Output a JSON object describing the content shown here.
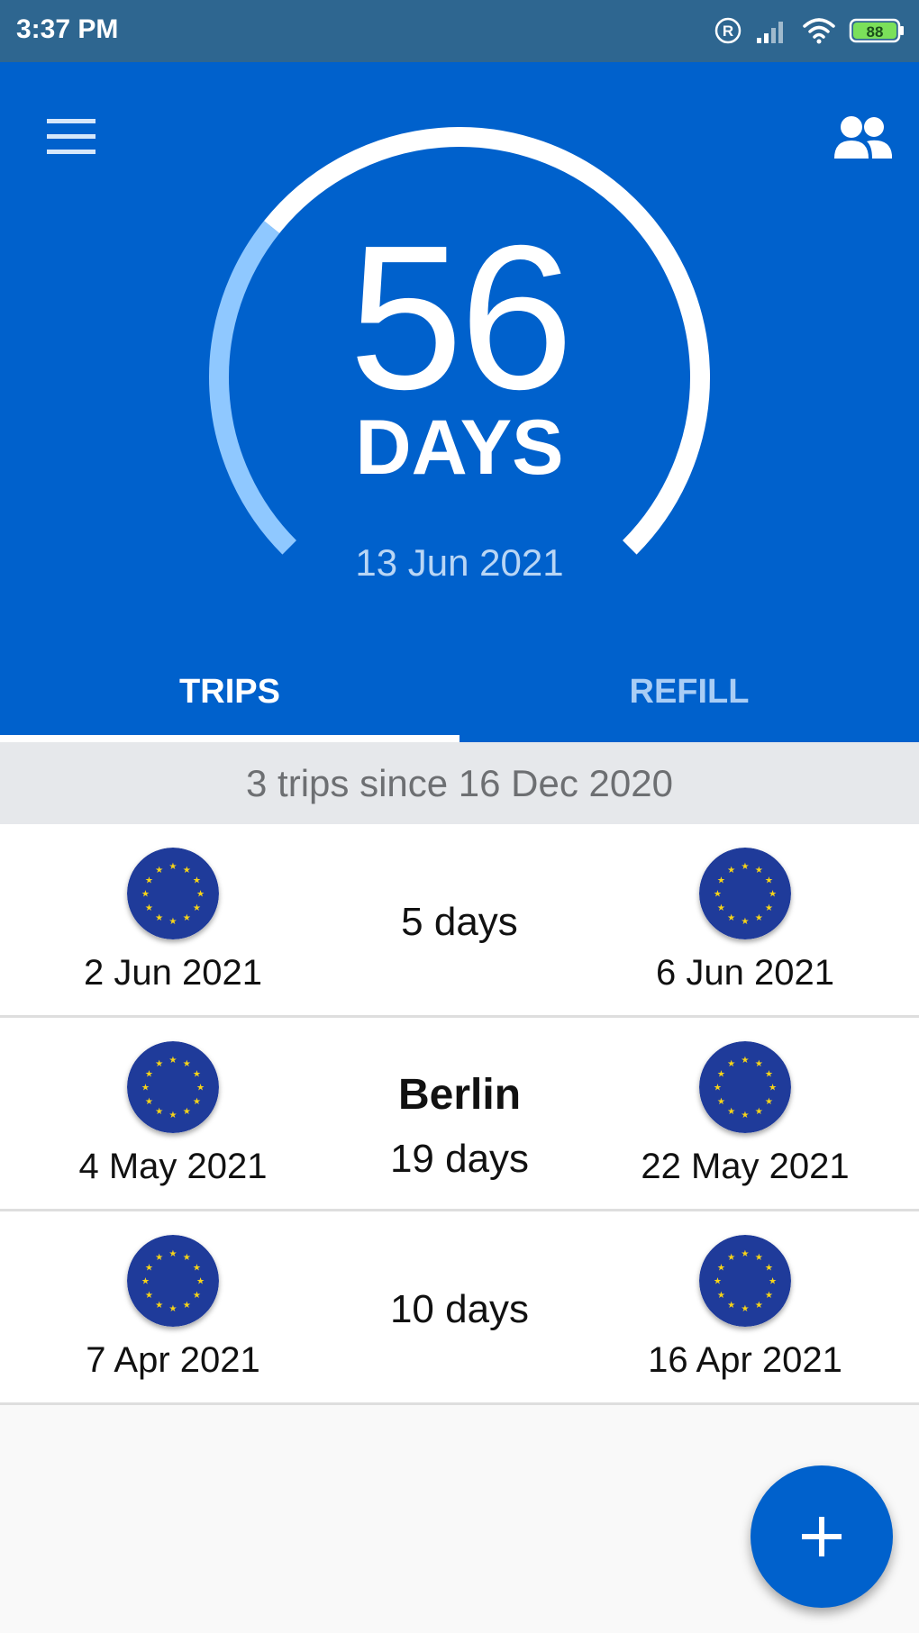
{
  "status_bar": {
    "time": "3:37 PM",
    "battery": "88"
  },
  "header": {
    "days_count": "56",
    "days_unit": "DAYS",
    "end_date": "13 Jun 2021",
    "gauge_fraction_used": 0.31
  },
  "tabs": [
    {
      "label": "TRIPS",
      "selected": true
    },
    {
      "label": "REFILL",
      "selected": false
    }
  ],
  "summary": "3 trips since 16 Dec 2020",
  "trips": [
    {
      "start_date": "2 Jun 2021",
      "end_date": "6 Jun 2021",
      "name": "",
      "duration": "5 days",
      "start_flag": "eu-flag-icon",
      "end_flag": "eu-flag-icon"
    },
    {
      "start_date": "4 May 2021",
      "end_date": "22 May 2021",
      "name": "Berlin",
      "duration": "19 days",
      "start_flag": "eu-flag-icon",
      "end_flag": "eu-flag-icon"
    },
    {
      "start_date": "7 Apr 2021",
      "end_date": "16 Apr 2021",
      "name": "",
      "duration": "10 days",
      "start_flag": "eu-flag-icon",
      "end_flag": "eu-flag-icon"
    }
  ],
  "colors": {
    "primary": "#0061cc",
    "status_bar": "#2e6690",
    "gauge_used": "#8fc8ff",
    "gauge_remaining": "#ffffff",
    "eu_blue": "#1f3b9a",
    "eu_gold": "#f7d418"
  },
  "icons": {
    "menu": "menu-icon",
    "people": "people-icon",
    "add": "plus-icon"
  }
}
